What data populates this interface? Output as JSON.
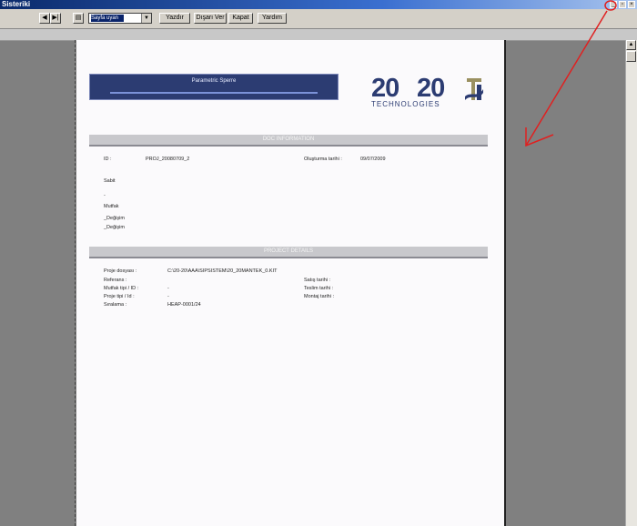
{
  "window": {
    "title": "Sisteriki"
  },
  "toolbar": {
    "nav_prev": "◀",
    "nav_next": "▶|",
    "zoom_value": "Sayfa uyan",
    "buttons": [
      "Yazdır",
      "Dışarı Ver",
      "Kapat",
      "Yardım"
    ]
  },
  "document": {
    "banner_title": "Parametric Sperre",
    "logo": {
      "num_a": "20",
      "num_b": "20",
      "tagline": "TECHNOLOGIES"
    },
    "section1": {
      "title": "DOC INFORMATION",
      "id_label": "ID :",
      "id_value": "PROJ_20080709_2",
      "date_label": "Oluşturma tarihi :",
      "date_value": "09/07/2009",
      "lines": [
        "Sabit",
        "-",
        "Mutfak",
        "_Değişim",
        "_Değişim"
      ]
    },
    "section2": {
      "title": "PROJECT DETAILS",
      "rows": [
        {
          "label": "Proje dosyası :",
          "value": "C:\\20-20\\AAA\\SIPSISTEM\\20_20MANTEK_0.KIT"
        },
        {
          "label": "Referans :",
          "value": ""
        },
        {
          "label": "Mutfak tipi / ID :",
          "value": "-"
        },
        {
          "label": "Proje tipi / Id :",
          "value": "-"
        },
        {
          "label": "Sıralama :",
          "value": "HEAP-0001/24"
        }
      ],
      "right_labels": [
        "Satış tarihi :",
        "Teslim tarihi :",
        "Montaj tarihi :"
      ]
    }
  },
  "colors": {
    "banner": "#2c3c72",
    "annotation_arrow": "#e02020"
  }
}
